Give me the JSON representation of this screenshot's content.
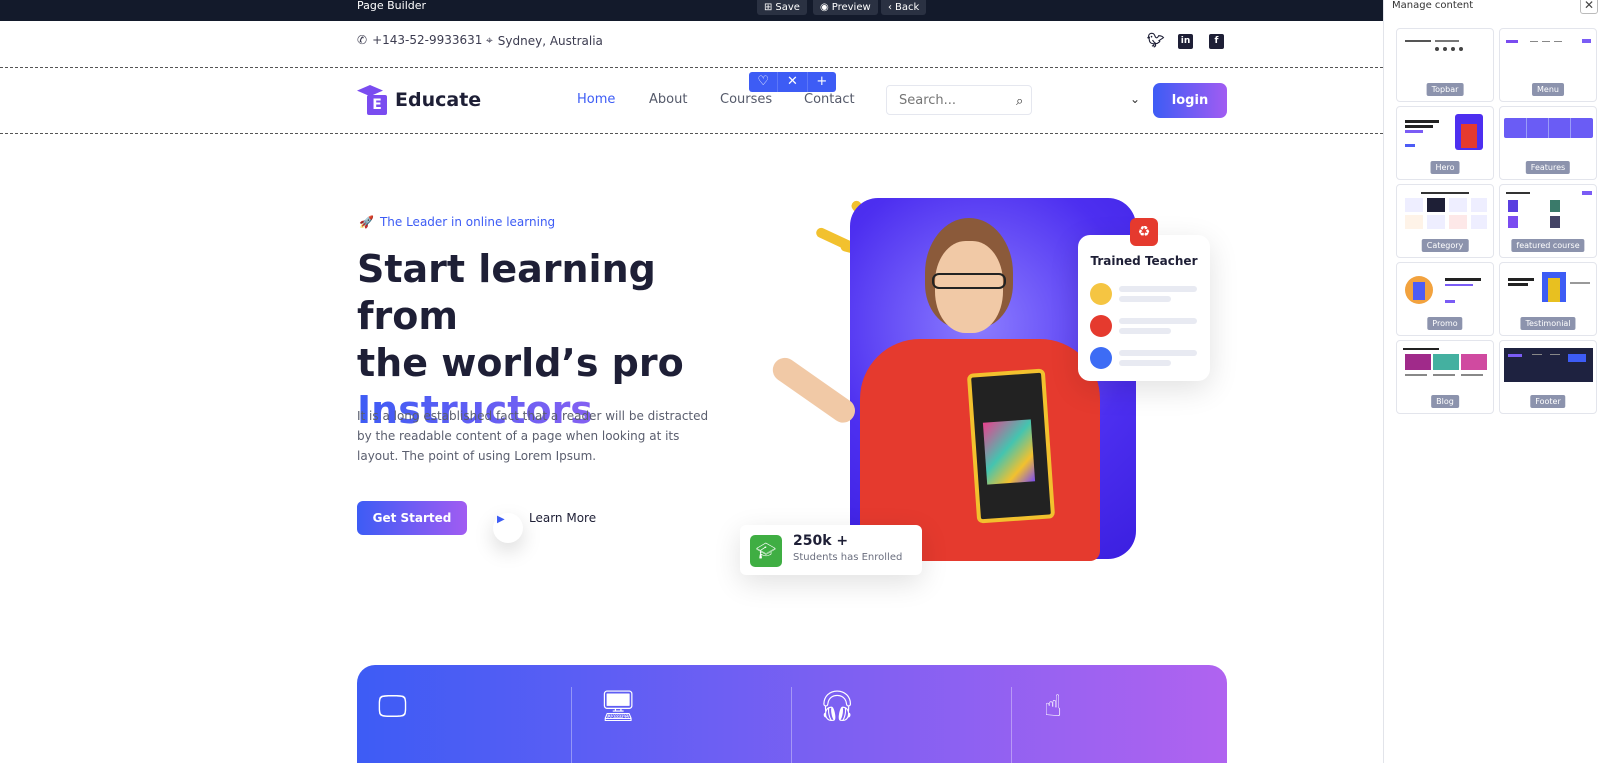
{
  "builder": {
    "title": "Page Builder",
    "save_label": "Save",
    "preview_label": "Preview",
    "back_label": "Back"
  },
  "topbar": {
    "phone": "+143-52-9933631",
    "location": "Sydney, Australia"
  },
  "menu": {
    "logo_text": "Educate",
    "items": [
      "Home",
      "About",
      "Courses",
      "Contact"
    ],
    "search_placeholder": "Search...",
    "login_label": "login"
  },
  "hero": {
    "tagline": "The Leader in online learning",
    "title_line1": "Start learning from",
    "title_line2": "the world’s pro",
    "title_highlight": "Instructors",
    "description": "It is a long established fact that a reader will be distracted by the readable content of a page when looking at its layout. The point of using Lorem Ipsum.",
    "cta_label": "Get Started",
    "learn_more_label": "Learn More",
    "teacher_card_title": "Trained Teacher",
    "enrolled_count": "250k +",
    "enrolled_label": "Students has Enrolled"
  },
  "panel": {
    "title": "Manage content",
    "blocks": [
      "Topbar",
      "Menu",
      "Hero",
      "Features",
      "Category",
      "featured course",
      "Promo",
      "Testimonial",
      "Blog",
      "Footer"
    ]
  },
  "colors": {
    "accent": "#3d5cf5",
    "accent_end": "#a15cf2",
    "builder_bar": "#131a2b"
  }
}
